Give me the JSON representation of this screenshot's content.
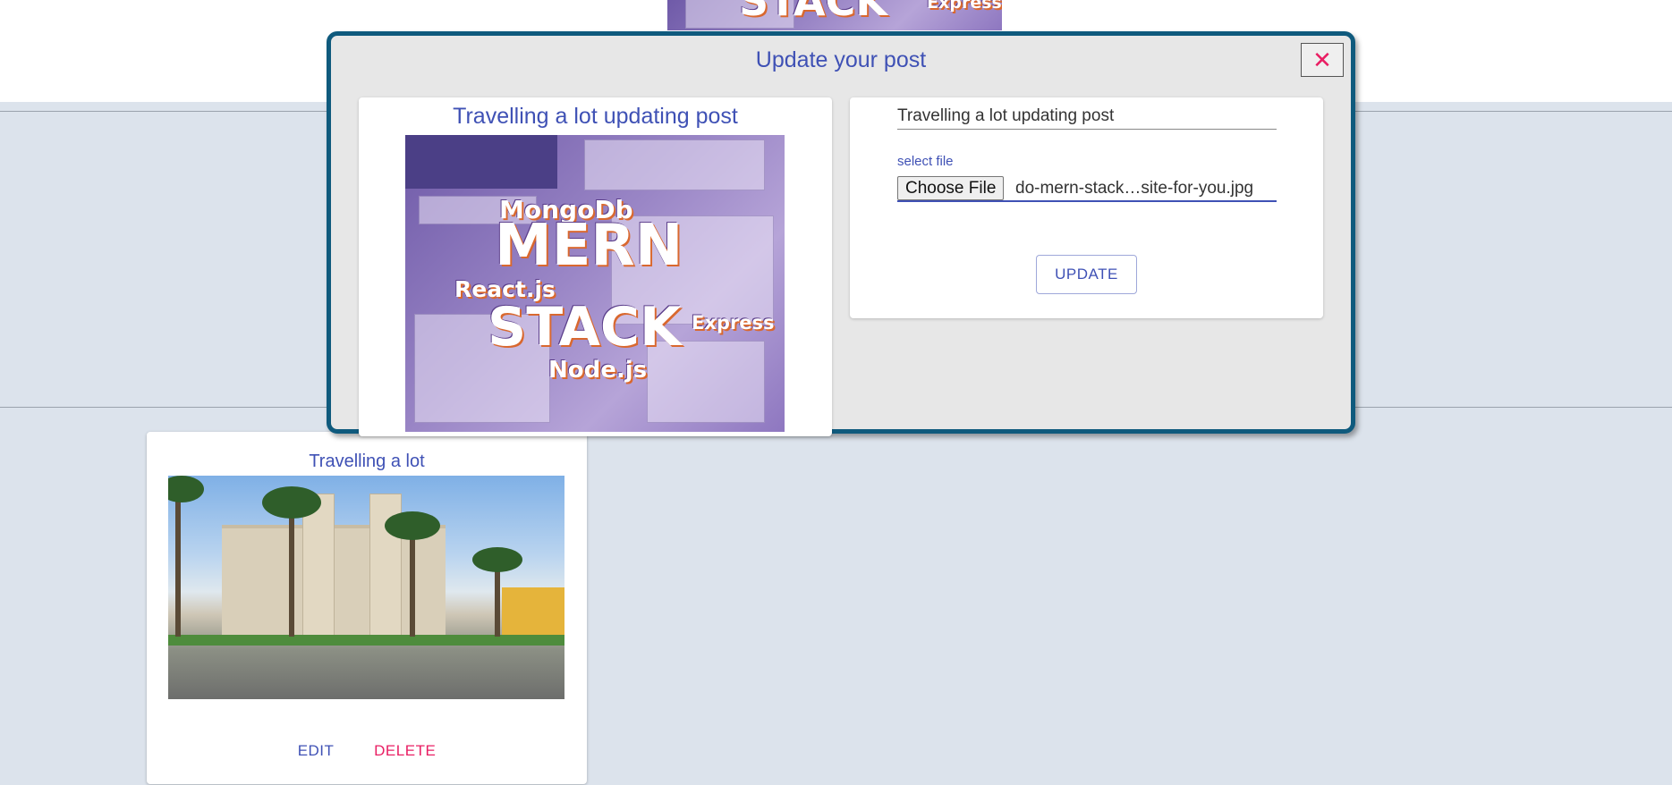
{
  "background_card": {
    "thumb_words": [
      "STACK",
      "Express"
    ]
  },
  "post_card": {
    "title": "Travelling a lot",
    "image_alt": "cathedral-plaza-photo",
    "edit_label": "EDIT",
    "delete_label": "DELETE"
  },
  "modal": {
    "title": "Update your post",
    "close_icon": "✕",
    "preview": {
      "title": "Travelling a lot updating post",
      "thumb_words": [
        "MongoDb",
        "MERN",
        "React.js",
        "STACK",
        "Express",
        "Node.js"
      ]
    },
    "form": {
      "title_value": "Travelling a lot updating post",
      "file_label": "select file",
      "choose_file_label": "Choose File",
      "file_name": "do-mern-stack…site-for-you.jpg",
      "update_label": "UPDATE"
    }
  },
  "colors": {
    "primary": "#3f51b5",
    "secondary": "#e91e63",
    "modal_border": "#0f5a7d",
    "page_bg": "#dce3ec"
  }
}
